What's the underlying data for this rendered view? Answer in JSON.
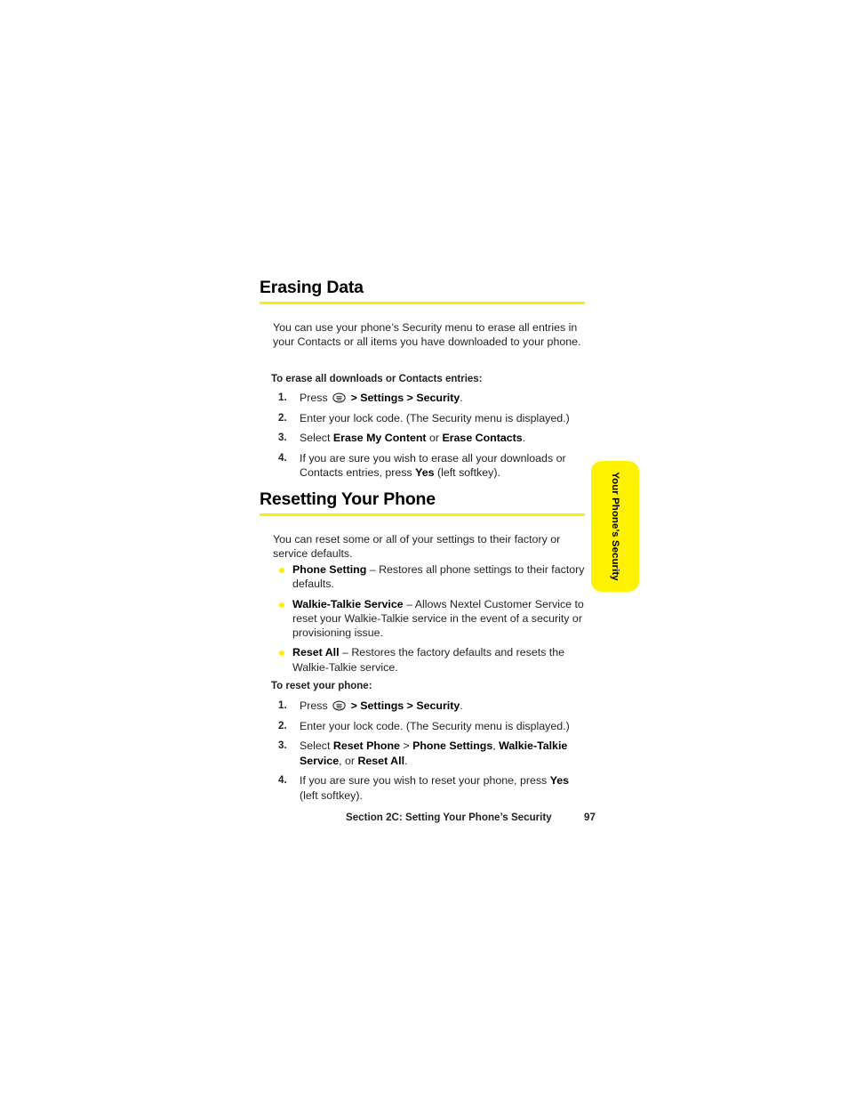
{
  "page": {
    "background": "#ffffff",
    "accent_yellow": "#ffed00",
    "tab_yellow": "#fff200",
    "text_color": "#231f20"
  },
  "sections": [
    {
      "id": "erasing",
      "title": "Erasing Data",
      "intro": "You can use your phone’s Security menu to erase all entries in your Contacts or all items you have downloaded to your phone.",
      "lead_in": "To erase all downloads or Contacts entries:",
      "steps": [
        {
          "num": "1.",
          "text_html": "Press [MENUKEY] <b>&gt;</b> <b>Settings</b> <b>&gt;</b> <b>Security</b>."
        },
        {
          "num": "2.",
          "text_html": "Enter your lock code. (The Security menu is displayed.)"
        },
        {
          "num": "3.",
          "text_html": "Select <b>Erase My Content</b> or <b>Erase Contacts</b>."
        },
        {
          "num": "4.",
          "text_html": "If you are sure you wish to erase all your downloads or Contacts entries, press <b>Yes</b> (left softkey)."
        }
      ]
    },
    {
      "id": "resetting",
      "title": "Resetting Your Phone",
      "intro": "You can reset some or all of your settings to their factory or service defaults.",
      "bullets": [
        {
          "term": "Phone Setting",
          "text_html": "<b>Phone Setting</b> – Restores all phone settings to their factory defaults."
        },
        {
          "term": "Walkie-Talkie Service",
          "text_html": "<b>Walkie-Talkie Service</b> – Allows Nextel Customer Service to reset your Walkie-Talkie service in the event of a security or provisioning issue."
        },
        {
          "term": "Reset All",
          "text_html": "<b>Reset All</b> – Restores the factory defaults and resets the Walkie-Talkie service."
        }
      ],
      "lead_in": "To reset your phone:",
      "steps": [
        {
          "num": "1.",
          "text_html": "Press [MENUKEY] <b>&gt;</b> <b>Settings</b> <b>&gt;</b> <b>Security</b>."
        },
        {
          "num": "2.",
          "text_html": "Enter your lock code. (The Security menu is displayed.)"
        },
        {
          "num": "3.",
          "text_html": "Select <b>Reset Phone</b> &gt; <b>Phone Settings</b>, <b>Walkie-Talkie Service</b>, or <b>Reset All</b>."
        },
        {
          "num": "4.",
          "text_html": "If you are sure you wish to reset your phone, press <b>Yes</b> (left softkey)."
        }
      ]
    }
  ],
  "side_tab": {
    "label": "Your Phone’s Security",
    "color": "#fff200"
  },
  "footer": {
    "section_label": "Section 2C: Setting Your Phone’s Security",
    "page_number": "97"
  },
  "icons": {
    "menu_key": "menu-key-icon"
  }
}
